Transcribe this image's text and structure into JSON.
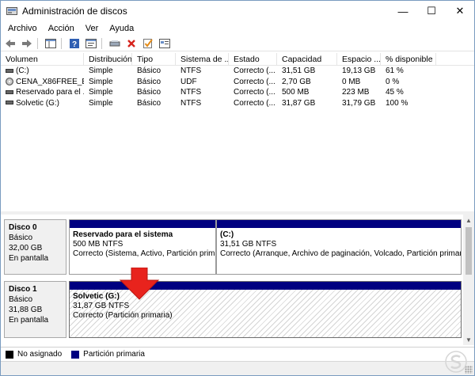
{
  "window": {
    "title": "Administración de discos",
    "buttons": {
      "minimize": "—",
      "maximize": "☐",
      "close": "✕"
    }
  },
  "menu": [
    "Archivo",
    "Acción",
    "Ver",
    "Ayuda"
  ],
  "toolbar": [
    "back-icon",
    "forward-icon",
    "console-tree-icon",
    "help-icon",
    "properties-icon",
    "connect-icon",
    "delete-icon",
    "check-icon",
    "settings-icon"
  ],
  "volume_list": {
    "headers": [
      "Volumen",
      "Distribución",
      "Tipo",
      "Sistema de ...",
      "Estado",
      "Capacidad",
      "Espacio ...",
      "% disponible"
    ],
    "rows": [
      [
        "(C:)",
        "Simple",
        "Básico",
        "NTFS",
        "Correcto (...",
        "31,51 GB",
        "19,13 GB",
        "61 %"
      ],
      [
        "CENA_X86FREE_ES...",
        "Simple",
        "Básico",
        "UDF",
        "Correcto (...",
        "2,70 GB",
        "0 MB",
        "0 %"
      ],
      [
        "Reservado para el ...",
        "Simple",
        "Básico",
        "NTFS",
        "Correcto (...",
        "500 MB",
        "223 MB",
        "45 %"
      ],
      [
        "Solvetic (G:)",
        "Simple",
        "Básico",
        "NTFS",
        "Correcto (...",
        "31,87 GB",
        "31,79 GB",
        "100 %"
      ]
    ]
  },
  "disks": [
    {
      "name": "Disco 0",
      "type": "Básico",
      "size": "32,00 GB",
      "status": "En pantalla",
      "partitions": [
        {
          "title": "Reservado para el sistema",
          "size_fs": "500 MB NTFS",
          "status": "Correcto (Sistema, Activo, Partición primaria"
        },
        {
          "title": "(C:)",
          "size_fs": "31,51 GB NTFS",
          "status": "Correcto (Arranque, Archivo de paginación, Volcado, Partición primaria"
        }
      ]
    },
    {
      "name": "Disco 1",
      "type": "Básico",
      "size": "31,88 GB",
      "status": "En pantalla",
      "partitions": [
        {
          "title": "Solvetic (G:)",
          "size_fs": "31,87 GB NTFS",
          "status": "Correcto (Partición primaria)"
        }
      ]
    }
  ],
  "legend": [
    {
      "label": "No asignado",
      "color": "#000000"
    },
    {
      "label": "Partición primaria",
      "color": "#000080"
    }
  ],
  "colors": {
    "accent_bar": "#000080",
    "annotation_arrow": "#e8231d"
  }
}
